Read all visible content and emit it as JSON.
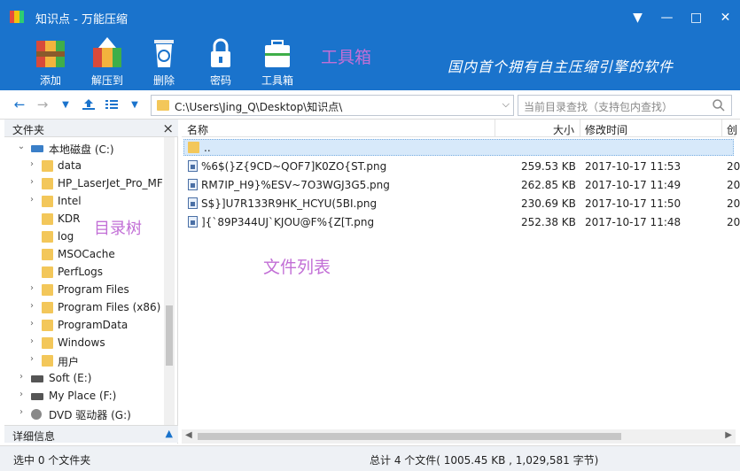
{
  "window": {
    "title": "知识点 - 万能压缩"
  },
  "titlebar_buttons": {
    "menu": "▼",
    "minimize": "—",
    "maximize": "□",
    "close": "✕"
  },
  "toolbar": {
    "add_label": "添加",
    "extract_label": "解压到",
    "delete_label": "删除",
    "password_label": "密码",
    "toolbox_label": "工具箱"
  },
  "annotations": {
    "toolbox": "工具箱",
    "tree": "目录树",
    "file_list": "文件列表"
  },
  "slogan": "国内首个拥有自主压缩引擎的软件",
  "nav": {
    "address": "C:\\Users\\Jing_Q\\Desktop\\知识点\\",
    "search_placeholder": "当前目录查找（支持包内查找）"
  },
  "folder_panel": {
    "title": "文件夹",
    "detail_title": "详细信息",
    "drive_c": "本地磁盘 (C:)",
    "folders": [
      "data",
      "HP_LaserJet_Pro_MF",
      "Intel",
      "KDR",
      "log",
      "MSOCache",
      "PerfLogs",
      "Program Files",
      "Program Files (x86)",
      "ProgramData",
      "Windows",
      "用户"
    ],
    "drives": [
      "Soft (E:)",
      "My Place (F:)",
      "DVD 驱动器 (G:)"
    ]
  },
  "file_list": {
    "columns": {
      "name": "名称",
      "size": "大小",
      "modified": "修改时间",
      "extra": "创"
    },
    "parent": "..",
    "rows": [
      {
        "name": "%6$(}Z{9CD~QOF7]K0ZO{ST.png",
        "size": "259.53 KB",
        "modified": "2017-10-17 11:53",
        "extra": "20"
      },
      {
        "name": "RM7IP_H9}%ESV~7O3WGJ3G5.png",
        "size": "262.85 KB",
        "modified": "2017-10-17 11:49",
        "extra": "20"
      },
      {
        "name": "S$}]U7R133R9HK_HCYU(5BI.png",
        "size": "230.69 KB",
        "modified": "2017-10-17 11:50",
        "extra": "20"
      },
      {
        "name": "]{`89P344UJ`KJOU@F%{Z[T.png",
        "size": "252.38 KB",
        "modified": "2017-10-17 11:48",
        "extra": "20"
      }
    ]
  },
  "status": {
    "selected": "选中 0 个文件夹",
    "total": "总计 4 个文件( 1005.45 KB , 1,029,581 字节)"
  }
}
